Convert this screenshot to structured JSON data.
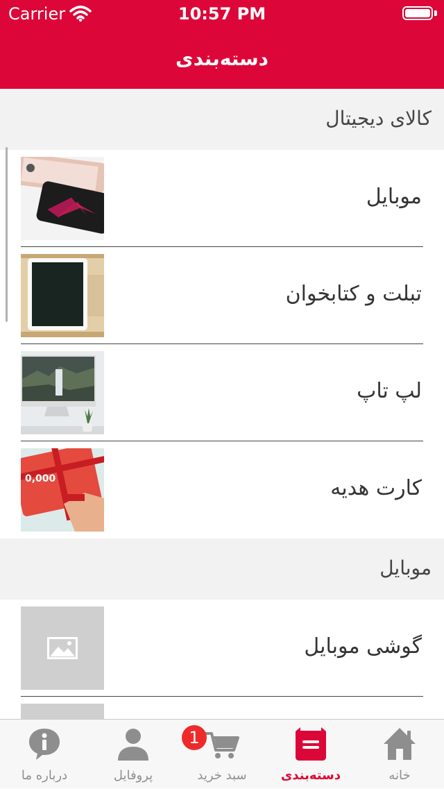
{
  "status_bar": {
    "carrier": "Carrier",
    "time": "10:57 PM"
  },
  "nav": {
    "title": "دسته‌بندی"
  },
  "sections": [
    {
      "title": "کالای دیجیتال",
      "items": [
        {
          "label": "موبایل",
          "image": "phones-photo"
        },
        {
          "label": "تبلت و کتابخوان",
          "image": "tablet-photo"
        },
        {
          "label": "لپ تاپ",
          "image": "desktop-photo"
        },
        {
          "label": "کارت هدیه",
          "image": "gift-card-photo"
        }
      ]
    },
    {
      "title": "موبایل",
      "items": [
        {
          "label": "گوشی موبایل",
          "image": "image-placeholder-icon"
        }
      ]
    }
  ],
  "tab_bar": {
    "tabs": [
      {
        "label": "درباره ما",
        "icon": "info-icon",
        "active": false
      },
      {
        "label": "پروفایل",
        "icon": "user-icon",
        "active": false
      },
      {
        "label": "سبد خرید",
        "icon": "cart-icon",
        "active": false
      },
      {
        "label": "دسته‌بندی",
        "icon": "category-icon",
        "active": true
      },
      {
        "label": "خانه",
        "icon": "home-icon",
        "active": false
      }
    ],
    "cart_badge": "1"
  },
  "colors": {
    "brand": "#dc0738",
    "inactive_tab": "#8e8e8e",
    "badge": "#ee2a2a"
  }
}
